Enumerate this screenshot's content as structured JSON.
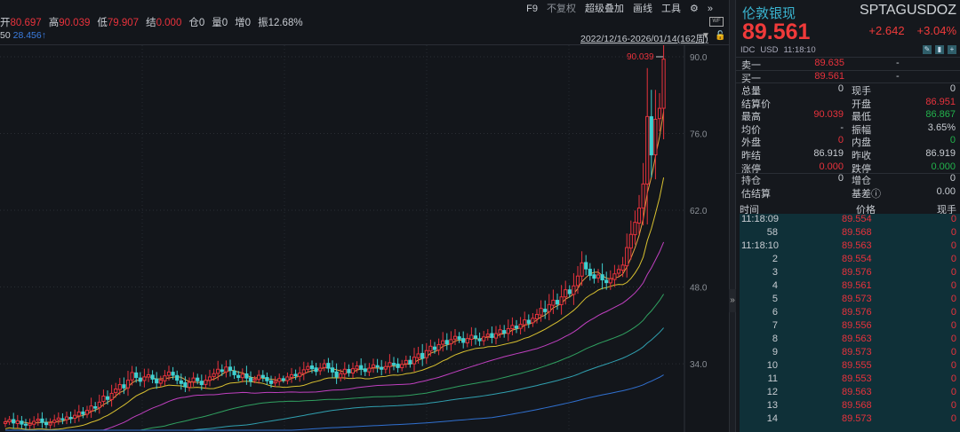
{
  "toolbar": {
    "items": [
      "F9",
      "不复权",
      "超级叠加",
      "画线",
      "工具"
    ],
    "gear_icon": "gear-icon",
    "expand_icon": "double-chevron-right-icon"
  },
  "ohlc": [
    {
      "label": "开",
      "value": "80.697"
    },
    {
      "label": "高",
      "value": "90.039"
    },
    {
      "label": "低",
      "value": "79.907"
    },
    {
      "label": "结",
      "value": "0.000"
    },
    {
      "label": "仓",
      "value": "0"
    },
    {
      "label": "量",
      "value": "0"
    },
    {
      "label": "增",
      "value": "0"
    },
    {
      "label": "振",
      "value": "12.68%"
    }
  ],
  "ma_row": {
    "label": "50",
    "value": "28.456↑"
  },
  "range": "2022/12/16-2026/01/14(162周)",
  "colors": {
    "up": "#e8323c",
    "down": "#3fd0d0",
    "ma": [
      "#e8a040",
      "#d8c030",
      "#c040c0",
      "#30a060",
      "#30a0b0",
      "#3070d0"
    ]
  },
  "chart_data": {
    "type": "candlestick",
    "period": "weekly",
    "y_ticks": [
      "90.0",
      "76.0",
      "62.0",
      "48.0",
      "34.0"
    ],
    "ylim": [
      20,
      92
    ],
    "high_label": "90.039",
    "closes": [
      23.4,
      23.8,
      23.2,
      23.6,
      23.0,
      22.8,
      23.1,
      23.5,
      23.9,
      23.3,
      22.9,
      23.2,
      23.7,
      24.1,
      23.8,
      24.3,
      24.0,
      24.6,
      25.2,
      24.8,
      25.5,
      26.3,
      25.9,
      27.0,
      28.1,
      27.5,
      28.6,
      29.4,
      30.2,
      29.6,
      31.0,
      32.4,
      31.5,
      30.8,
      31.6,
      32.0,
      31.2,
      30.5,
      31.0,
      31.8,
      32.5,
      31.9,
      31.0,
      30.4,
      29.8,
      30.6,
      31.4,
      30.9,
      30.2,
      31.0,
      31.6,
      32.2,
      33.0,
      32.6,
      33.4,
      32.8,
      32.0,
      31.5,
      32.1,
      31.4,
      30.8,
      31.2,
      31.9,
      31.5,
      30.9,
      30.4,
      30.8,
      31.3,
      31.0,
      31.6,
      32.0,
      31.8,
      32.3,
      32.9,
      33.5,
      33.1,
      32.6,
      33.2,
      34.0,
      33.2,
      32.5,
      31.6,
      32.2,
      33.0,
      32.4,
      33.1,
      33.6,
      33.0,
      32.6,
      33.2,
      33.8,
      33.4,
      33.0,
      33.5,
      34.2,
      33.8,
      33.3,
      33.9,
      34.6,
      34.0,
      35.2,
      35.8,
      35.0,
      36.4,
      37.2,
      36.6,
      37.5,
      38.2,
      37.6,
      38.4,
      39.0,
      38.5,
      37.9,
      38.6,
      39.2,
      38.7,
      38.2,
      38.9,
      39.4,
      38.8,
      39.5,
      40.2,
      39.6,
      40.4,
      41.0,
      40.5,
      41.2,
      42.0,
      41.4,
      42.3,
      43.0,
      44.1,
      43.5,
      44.8,
      45.6,
      44.9,
      46.2,
      47.5,
      46.8,
      48.2,
      50.0,
      52.4,
      51.3,
      50.1,
      49.6,
      50.2,
      49.3,
      48.8,
      49.5,
      50.4,
      51.2,
      52.0,
      55.2,
      57.6,
      59.8,
      62.4,
      66.8,
      79.1,
      72.1,
      78.6,
      80.6,
      89.561
    ],
    "ma_periods": [
      5,
      10,
      20,
      40,
      60,
      120
    ]
  },
  "panel": {
    "name": "伦敦银现",
    "code": "SPTAGUSDOZ",
    "price": "89.561",
    "change": "+2.642",
    "change_pct": "+3.04%",
    "source": "IDC",
    "currency": "USD",
    "time": "11:18:10",
    "ask": {
      "label": "卖一",
      "price": "89.635",
      "vol": "-"
    },
    "bid": {
      "label": "买一",
      "price": "89.561",
      "vol": "-"
    },
    "stats": [
      [
        {
          "l": "总量",
          "v": "0",
          "c": "gray"
        },
        {
          "l": "现手",
          "v": "0",
          "c": "gray"
        }
      ],
      [
        {
          "l": "结算价",
          "v": "",
          "c": "gray"
        },
        {
          "l": "开盘",
          "v": "86.951",
          "c": "red"
        }
      ],
      [
        {
          "l": "最高",
          "v": "90.039",
          "c": "red"
        },
        {
          "l": "最低",
          "v": "86.867",
          "c": "green"
        }
      ],
      [
        {
          "l": "均价",
          "v": "-",
          "c": "gray"
        },
        {
          "l": "振幅",
          "v": "3.65%",
          "c": "gray"
        }
      ],
      [
        {
          "l": "外盘",
          "v": "0",
          "c": "red"
        },
        {
          "l": "内盘",
          "v": "0",
          "c": "green"
        }
      ],
      [
        {
          "l": "昨结",
          "v": "86.919",
          "c": "gray"
        },
        {
          "l": "昨收",
          "v": "86.919",
          "c": "gray"
        }
      ],
      [
        {
          "l": "涨停",
          "v": "0.000",
          "c": "red"
        },
        {
          "l": "跌停",
          "v": "0.000",
          "c": "green"
        }
      ]
    ],
    "stats2": [
      [
        {
          "l": "持仓",
          "v": "0",
          "c": "gray"
        },
        {
          "l": "增仓",
          "v": "0",
          "c": "gray"
        }
      ],
      [
        {
          "l": "估结算",
          "v": "",
          "c": "gray"
        },
        {
          "l": "基差ⓘ",
          "v": "0.00",
          "c": "gray"
        }
      ]
    ],
    "tick_headers": [
      "时间",
      "价格",
      "现手"
    ],
    "ticks": [
      [
        "11:18:09",
        "89.554",
        "0"
      ],
      [
        "58",
        "89.568",
        "0"
      ],
      [
        "11:18:10",
        "89.563",
        "0"
      ],
      [
        "2",
        "89.554",
        "0"
      ],
      [
        "3",
        "89.576",
        "0"
      ],
      [
        "4",
        "89.561",
        "0"
      ],
      [
        "5",
        "89.573",
        "0"
      ],
      [
        "6",
        "89.576",
        "0"
      ],
      [
        "7",
        "89.556",
        "0"
      ],
      [
        "8",
        "89.563",
        "0"
      ],
      [
        "9",
        "89.573",
        "0"
      ],
      [
        "10",
        "89.555",
        "0"
      ],
      [
        "11",
        "89.553",
        "0"
      ],
      [
        "12",
        "89.563",
        "0"
      ],
      [
        "13",
        "89.568",
        "0"
      ],
      [
        "14",
        "89.573",
        "0"
      ]
    ]
  }
}
